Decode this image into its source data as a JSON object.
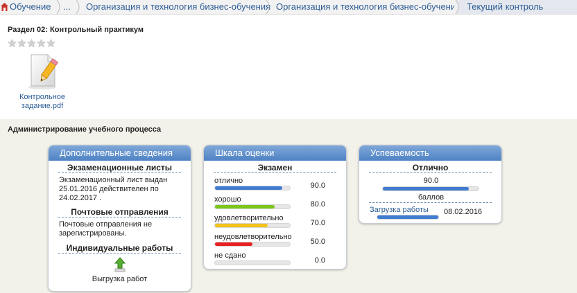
{
  "breadcrumbs": [
    {
      "label": "Обучение"
    },
    {
      "label": "..."
    },
    {
      "label": "Организация и технология бизнес-обучения"
    },
    {
      "label": "Организация и технология бизнес-обучения"
    },
    {
      "label": "Текущий контроль"
    }
  ],
  "section": {
    "title": "Раздел 02: Контрольный практикум",
    "rating": {
      "value": 0,
      "max": 5
    }
  },
  "file": {
    "label_line1": "Контрольное",
    "label_line2": "задание.pdf",
    "icon": "document-edit-icon"
  },
  "admin": {
    "title": "Администрирование учебного процесса",
    "info": {
      "header": "Дополнительные сведения",
      "exam_sheets_title": "Экзаменационные листы",
      "exam_sheets_text": "Экзаменационный лист выдан 25.01.2016 действителен по 24.02.2017 .",
      "mail_title": "Почтовые отправления",
      "mail_text": "Почтовые отправления не зарегистрированы.",
      "individual_title": "Индивидуальные работы",
      "upload_label": "Выгрузка работ"
    },
    "scale": {
      "header": "Шкала оценки",
      "subheader": "Экзамен",
      "rows": [
        {
          "label": "отлично",
          "value": "90.0",
          "fill": 0.9,
          "color": "#3f7bd1"
        },
        {
          "label": "хорошо",
          "value": "80.0",
          "fill": 0.8,
          "color": "#7cc51d"
        },
        {
          "label": "удовлетворительно",
          "value": "70.0",
          "fill": 0.7,
          "color": "#f2c21a"
        },
        {
          "label": "неудовлетворительно",
          "value": "50.0",
          "fill": 0.5,
          "color": "#e8201f"
        },
        {
          "label": "не сдано",
          "value": "0.0",
          "fill": 0.0,
          "color": "#cccccc"
        }
      ]
    },
    "progress": {
      "header": "Успеваемость",
      "grade": "Отлично",
      "score": "90.0",
      "score_fill": 0.9,
      "score_unit": "баллов",
      "upload_link": "Загрузка работы",
      "upload_date": "08.02.2016",
      "upload_fill": 1.0
    }
  }
}
